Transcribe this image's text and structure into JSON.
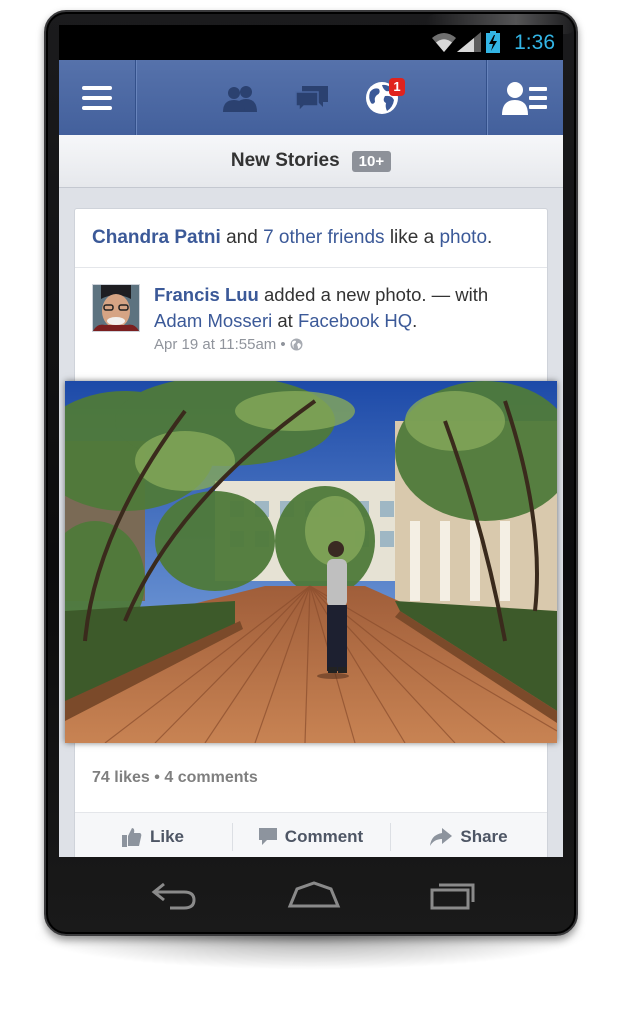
{
  "status_bar": {
    "time": "1:36"
  },
  "nav_bar": {
    "menu_icon": "hamburger-menu-icon",
    "friend_requests_icon": "friends-icon",
    "messages_icon": "messages-icon",
    "notifications_icon": "globe-icon",
    "notification_count": "1",
    "chat_icon": "chat-list-icon"
  },
  "new_stories": {
    "label": "New Stories",
    "count": "10+"
  },
  "story": {
    "header": {
      "actor": "Chandra Patni",
      "connector": "and",
      "others": "7 other friends",
      "action": "like a",
      "object": "photo",
      "end": "."
    },
    "post": {
      "author": "Francis Luu",
      "action": "added a new photo. — with",
      "tagged": "Adam Mosseri",
      "at": "at",
      "place": "Facebook HQ",
      "end": ".",
      "timestamp": "Apr 19 at 11:55am",
      "sep": "•",
      "privacy_icon": "globe-public-icon"
    },
    "likes": "74 likes",
    "dot": "•",
    "comments": "4 comments",
    "actions": {
      "like": "Like",
      "comment": "Comment",
      "share": "Share"
    }
  },
  "softkeys": {
    "back": "back-icon",
    "home": "home-icon",
    "recents": "recent-apps-icon"
  },
  "colors": {
    "brand_blue": "#3b5998",
    "navbar": "#4a67a1",
    "holo_blue": "#33b5e5",
    "badge_red": "#e0231d"
  }
}
